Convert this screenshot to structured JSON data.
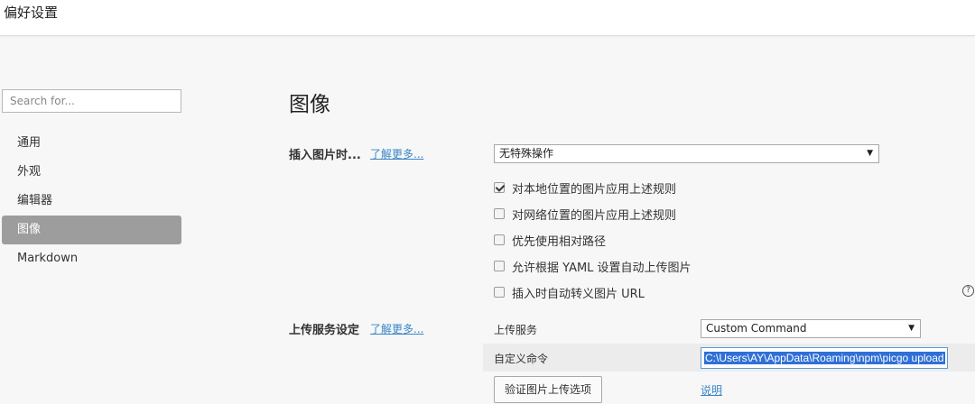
{
  "window": {
    "title": "偏好设置"
  },
  "search": {
    "placeholder": "Search for..."
  },
  "sidebar": {
    "items": [
      {
        "label": "通用"
      },
      {
        "label": "外观"
      },
      {
        "label": "编辑器"
      },
      {
        "label": "图像",
        "active": true
      },
      {
        "label": "Markdown"
      }
    ]
  },
  "main": {
    "title": "图像",
    "insert_section": {
      "label": "插入图片时...",
      "learn_more": "了解更多...",
      "select_value": "无特殊操作",
      "options": [
        {
          "label": "对本地位置的图片应用上述规则",
          "checked": true
        },
        {
          "label": "对网络位置的图片应用上述规则",
          "checked": false
        },
        {
          "label": "优先使用相对路径",
          "checked": false
        },
        {
          "label": "允许根据 YAML 设置自动上传图片",
          "checked": false
        },
        {
          "label": "插入时自动转义图片 URL",
          "checked": false
        }
      ]
    },
    "upload_section": {
      "label": "上传服务设定",
      "learn_more": "了解更多...",
      "service_label": "上传服务",
      "service_value": "Custom Command",
      "command_label": "自定义命令",
      "command_value": "C:\\Users\\AY\\AppData\\Roaming\\npm\\picgo upload",
      "verify_button": "验证图片上传选项",
      "docs_link": "说明"
    }
  },
  "icons": {
    "help": "question-circle-icon",
    "dropdown": "triangle-down-icon",
    "check": "checkmark-icon"
  },
  "colors": {
    "accent_link": "#3a86c8",
    "active_nav_bg": "#9d9d9d",
    "selection": "#2f6fd6"
  }
}
